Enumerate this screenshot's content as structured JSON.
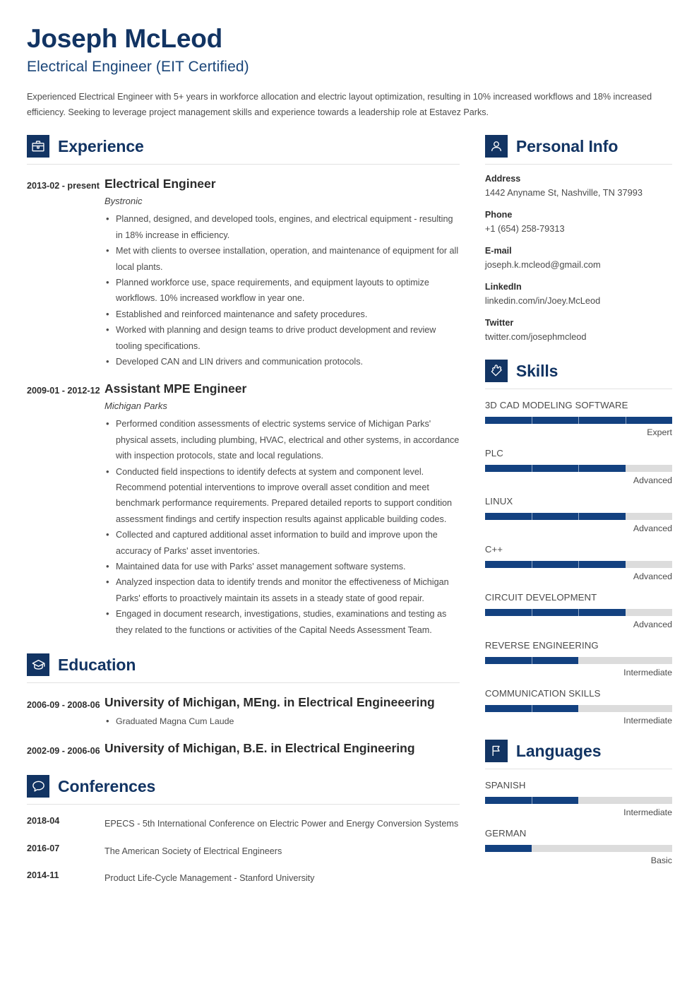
{
  "header": {
    "name": "Joseph McLeod",
    "job_title": "Electrical Engineer (EIT Certified)",
    "summary": "Experienced Electrical Engineer with 5+ years in workforce allocation and electric layout optimization, resulting in 10% increased workflows and 18% increased efficiency. Seeking to leverage project management skills and experience towards a leadership role at Estavez Parks."
  },
  "colors": {
    "primary": "#123463",
    "bar_fill": "#134180",
    "bar_track": "#dcdcdc",
    "heading": "#123463",
    "body_text": "#4b4b4b"
  },
  "sections": {
    "experience": {
      "title": "Experience",
      "icon": "briefcase-icon",
      "entries": [
        {
          "date": "2013-02 - present",
          "role": "Electrical Engineer",
          "org": "Bystronic",
          "bullets": [
            "Planned, designed, and developed tools, engines, and electrical equipment - resulting in 18% increase in efficiency.",
            "Met with clients to oversee installation, operation, and maintenance of equipment for all local plants.",
            "Planned workforce use, space requirements, and equipment layouts to optimize workflows. 10% increased workflow in year one.",
            "Established and reinforced maintenance and safety procedures.",
            "Worked with planning and design teams to drive product development and review tooling specifications.",
            "Developed CAN and LIN drivers and communication protocols."
          ]
        },
        {
          "date": "2009-01 - 2012-12",
          "role": "Assistant MPE Engineer",
          "org": "Michigan Parks",
          "bullets": [
            "Performed condition assessments of electric systems service of Michigan Parks' physical assets, including plumbing, HVAC, electrical and other systems, in accordance with inspection protocols, state and local regulations.",
            "Conducted field inspections to identify defects at system and component level. Recommend potential interventions to improve overall asset condition and meet benchmark performance requirements. Prepared detailed reports to support condition assessment findings and certify inspection results against applicable building codes.",
            "Collected and captured additional asset information to build and improve upon the accuracy of Parks' asset inventories.",
            "Maintained data for use with Parks' asset management software systems.",
            "Analyzed inspection data to identify trends and monitor the effectiveness of Michigan Parks' efforts to proactively maintain its assets in a steady state of good repair.",
            "Engaged in document research, investigations, studies, examinations and testing as they related to the functions or activities of the Capital Needs Assessment Team."
          ]
        }
      ]
    },
    "education": {
      "title": "Education",
      "icon": "graduation-cap-icon",
      "entries": [
        {
          "date": "2006-09 - 2008-06",
          "degree": "University of Michigan, MEng. in Electrical Engineeering",
          "bullets": [
            "Graduated Magna Cum Laude"
          ]
        },
        {
          "date": "2002-09 - 2006-06",
          "degree": "University of Michigan, B.E. in Electrical Engineering",
          "bullets": []
        }
      ]
    },
    "conferences": {
      "title": "Conferences",
      "icon": "speech-bubble-icon",
      "entries": [
        {
          "date": "2018-04",
          "text": "EPECS - 5th International Conference on Electric Power and Energy Conversion Systems"
        },
        {
          "date": "2016-07",
          "text": "The American Society of Electrical Engineers"
        },
        {
          "date": "2014-11",
          "text": "Product Life-Cycle Management - Stanford University"
        }
      ]
    },
    "personal_info": {
      "title": "Personal Info",
      "icon": "person-icon",
      "items": [
        {
          "label": "Address",
          "value": "1442 Anyname St, Nashville, TN 37993"
        },
        {
          "label": "Phone",
          "value": "+1 (654) 258-79313"
        },
        {
          "label": "E-mail",
          "value": "joseph.k.mcleod@gmail.com"
        },
        {
          "label": "LinkedIn",
          "value": "linkedin.com/in/Joey.McLeod"
        },
        {
          "label": "Twitter",
          "value": "twitter.com/josephmcleod"
        }
      ]
    },
    "skills": {
      "title": "Skills",
      "icon": "puzzle-piece-icon",
      "items": [
        {
          "name": "3D CAD MODELING SOFTWARE",
          "level": "Expert",
          "percent": 100
        },
        {
          "name": "PLC",
          "level": "Advanced",
          "percent": 75
        },
        {
          "name": "LINUX",
          "level": "Advanced",
          "percent": 75
        },
        {
          "name": "C++",
          "level": "Advanced",
          "percent": 75
        },
        {
          "name": "CIRCUIT DEVELOPMENT",
          "level": "Advanced",
          "percent": 75
        },
        {
          "name": "REVERSE ENGINEERING",
          "level": "Intermediate",
          "percent": 50
        },
        {
          "name": "COMMUNICATION SKILLS",
          "level": "Intermediate",
          "percent": 50
        }
      ]
    },
    "languages": {
      "title": "Languages",
      "icon": "flag-icon",
      "items": [
        {
          "name": "SPANISH",
          "level": "Intermediate",
          "percent": 50
        },
        {
          "name": "GERMAN",
          "level": "Basic",
          "percent": 25
        }
      ]
    }
  }
}
